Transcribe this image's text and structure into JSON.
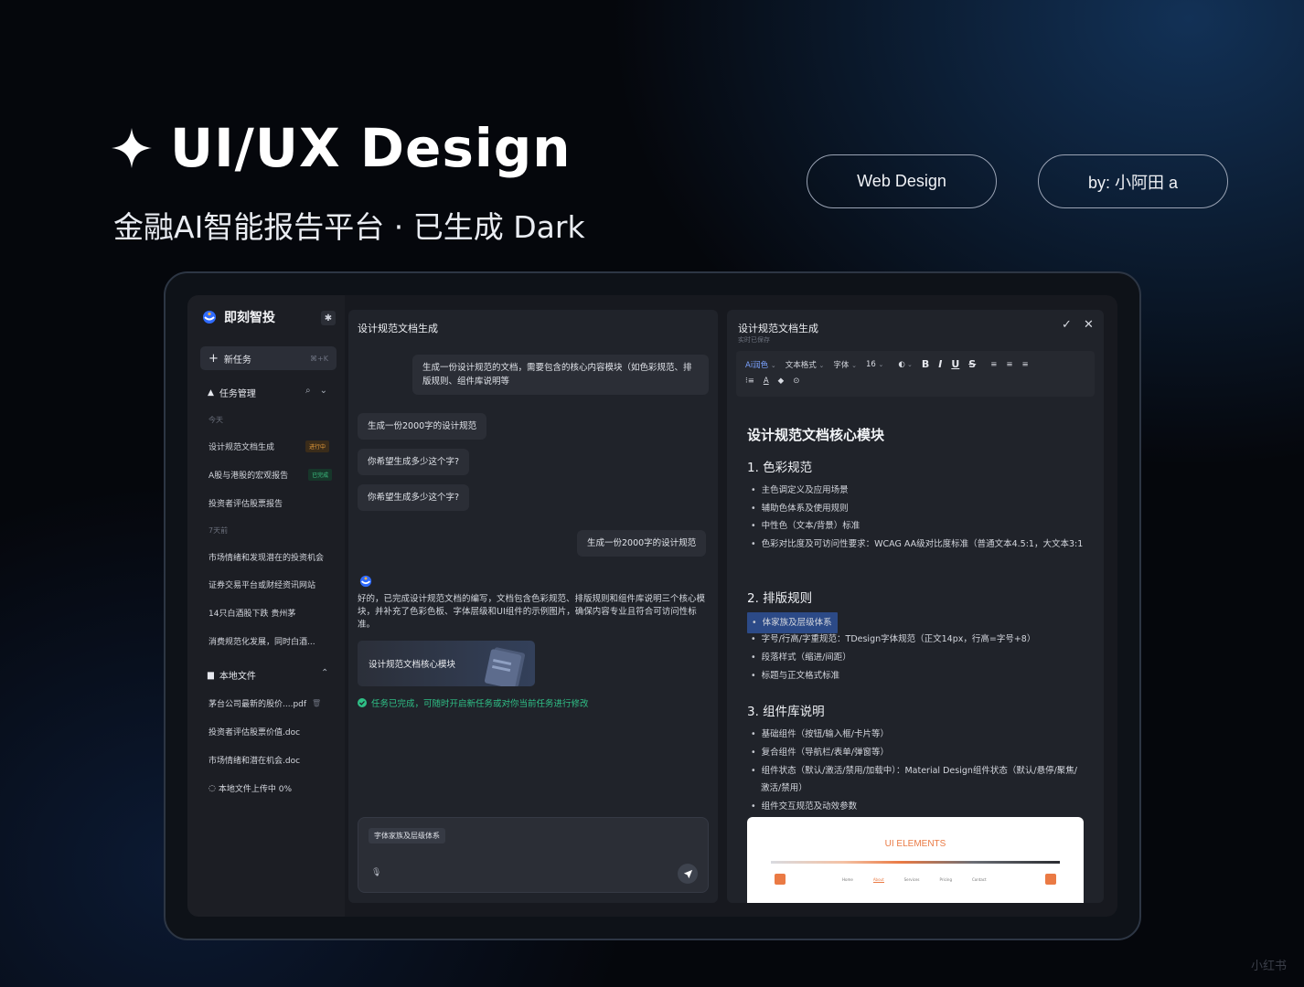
{
  "hero": {
    "title": "UI/UX Design",
    "subtitle": "金融AI智能报告平台 · 已生成 Dark",
    "pill_left": "Web Design",
    "pill_right": "by: 小阿田 a"
  },
  "sidebar": {
    "app_name": "即刻智投",
    "new_task_label": "新任务",
    "new_task_shortcut": "⌘+K",
    "task_section": "任务管理",
    "group_today": "今天",
    "today_items": [
      {
        "label": "设计规范文档生成",
        "badge": "进行中"
      },
      {
        "label": "A股与港股的宏观报告",
        "badge": "已完成"
      },
      {
        "label": "投资者评估股票报告",
        "badge": ""
      }
    ],
    "group_7days": "7天前",
    "week_items": [
      "市场情绪和发现潜在的投资机会",
      "证券交易平台或财经资讯网站",
      "14只白酒股下跌 贵州茅",
      "消费规范化发展，同时白酒..."
    ],
    "local_section": "本地文件",
    "files": [
      "茅台公司最新的股价....pdf",
      "投资者评估股票价值.doc",
      "市场情绪和潜在机会.doc"
    ],
    "upload_status": "本地文件上传中 0%"
  },
  "chat": {
    "title": "设计规范文档生成",
    "messages": [
      {
        "role": "user",
        "text": "生成一份设计规范的文档，需要包含的核心内容模块（如色彩规范、排版规则、组件库说明等"
      },
      {
        "role": "assistant",
        "text": "生成一份2000字的设计规范"
      },
      {
        "role": "assistant",
        "text": "你希望生成多少这个字?"
      },
      {
        "role": "assistant",
        "text": "你希望生成多少这个字?"
      },
      {
        "role": "user",
        "text": "生成一份2000字的设计规范"
      }
    ],
    "ai_reply": "好的，已完成设计规范文档的编写，文档包含色彩规范、排版规则和组件库说明三个核心模块，并补充了色彩色板、字体层级和UI组件的示例图片，确保内容专业且符合可访问性标准。",
    "doc_card_label": "设计规范文档核心模块",
    "status_done": "任务已完成，可随时开启新任务或对你当前任务进行修改",
    "input_chip": "字体家族及层级体系"
  },
  "editor": {
    "title": "设计规范文档生成",
    "saved_status": "实时已保存",
    "toolbar": {
      "ai_color": "Ai润色",
      "text_format": "文本格式",
      "font": "字体",
      "size": "16"
    },
    "doc_title": "设计规范文档核心模块",
    "sections": [
      {
        "heading": "1. 色彩规范",
        "items": [
          "主色调定义及应用场景",
          "辅助色体系及使用规则",
          "中性色（文本/背景）标准",
          "色彩对比度及可访问性要求：WCAG AA级对比度标准（普通文本4.5:1，大文本3:1"
        ]
      },
      {
        "heading": "2. 排版规则",
        "items": [
          "体家族及层级体系",
          "字号/行高/字重规范：TDesign字体规范（正文14px，行高=字号+8）",
          "段落样式（缩进/间距）",
          "标题与正文格式标准"
        ]
      },
      {
        "heading": "3. 组件库说明",
        "items": [
          "基础组件（按钮/输入框/卡片等）",
          "复合组件（导航栏/表单/弹窗等）",
          "组件状态（默认/激活/禁用/加载中）：Material Design组件状态（默认/悬停/聚焦/激活/禁用）",
          "组件交互规范及动效参数"
        ]
      }
    ],
    "preview_title": "UI ELEMENTS",
    "preview_nav": [
      "Home",
      "About",
      "Services",
      "Pricing",
      "Contact"
    ]
  },
  "watermark": "小红书",
  "colors": {
    "accent_blue": "#2c4a87",
    "success": "#2fbf86",
    "running": "#e39a3b",
    "preview_orange": "#ea7a44"
  }
}
